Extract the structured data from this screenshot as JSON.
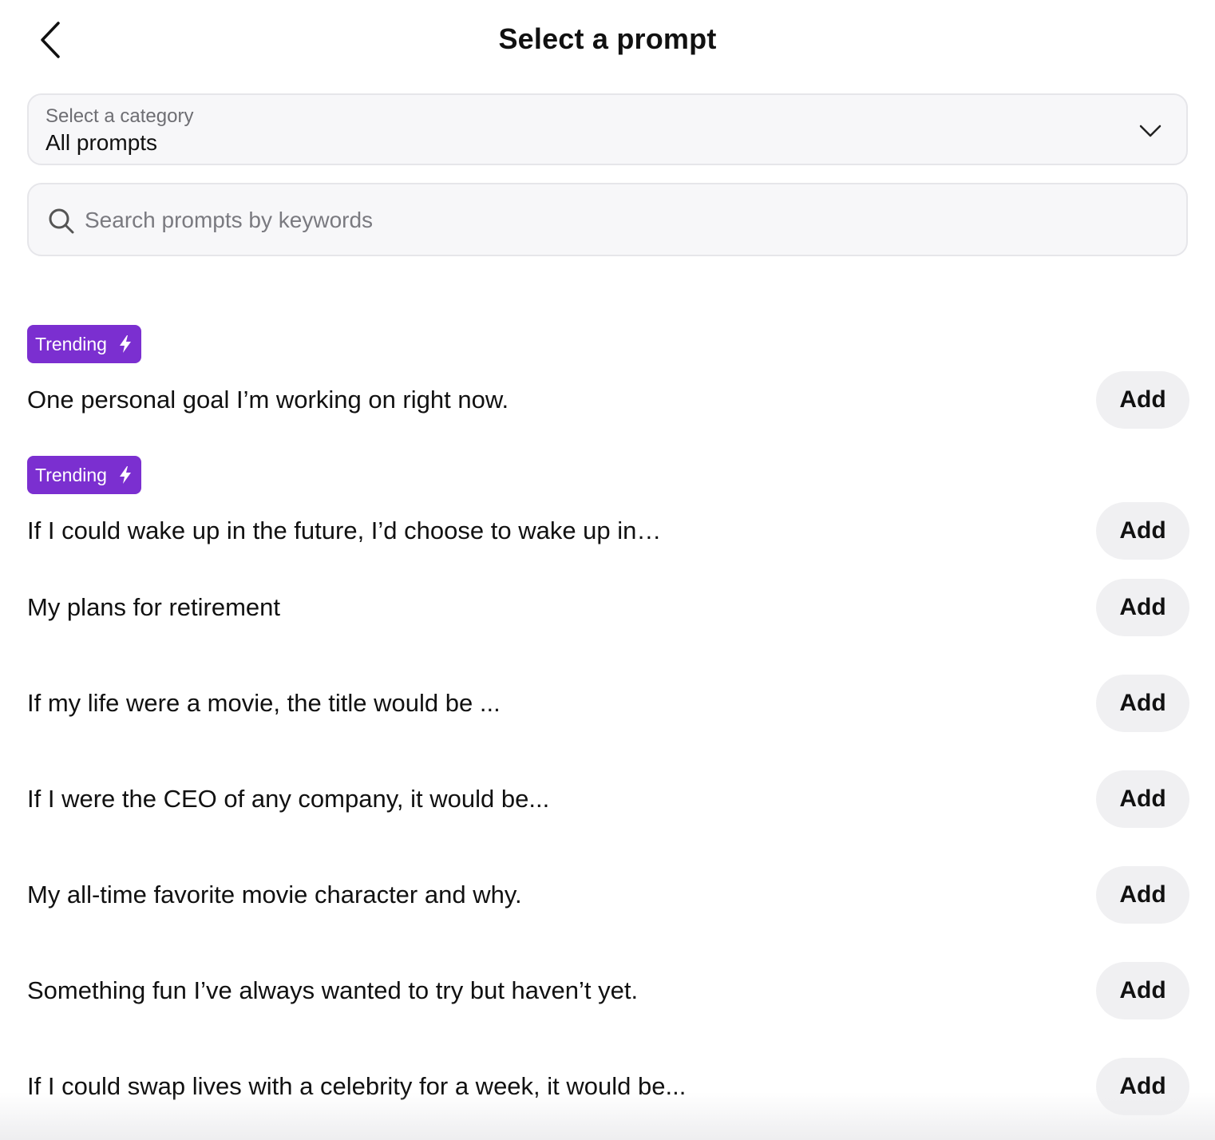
{
  "header": {
    "title": "Select a prompt",
    "back_icon": "chevron-left-icon"
  },
  "category": {
    "label": "Select a category",
    "value": "All prompts",
    "icon": "chevron-down-icon"
  },
  "search": {
    "placeholder": "Search prompts by keywords",
    "value": "",
    "icon": "search-icon"
  },
  "badge": {
    "label": "Trending",
    "icon": "bolt-icon",
    "color": "#7b2fd0"
  },
  "prompts": [
    {
      "text": "One personal goal I’m working on right now.",
      "trending": true,
      "action": "Add"
    },
    {
      "text": "If I could wake up in the future, I’d choose to wake up in…",
      "trending": true,
      "action": "Add"
    },
    {
      "text": "My plans for retirement",
      "trending": false,
      "action": "Add"
    },
    {
      "text": "If my life were a movie, the title would be ...",
      "trending": false,
      "action": "Add"
    },
    {
      "text": "If I were the CEO of any company, it would be...",
      "trending": false,
      "action": "Add"
    },
    {
      "text": "My all-time favorite movie character and why.",
      "trending": false,
      "action": "Add"
    },
    {
      "text": "Something fun I’ve always wanted to try but haven’t yet.",
      "trending": false,
      "action": "Add"
    },
    {
      "text": "If I could swap lives with a celebrity for a week, it would be...",
      "trending": false,
      "action": "Add"
    }
  ]
}
